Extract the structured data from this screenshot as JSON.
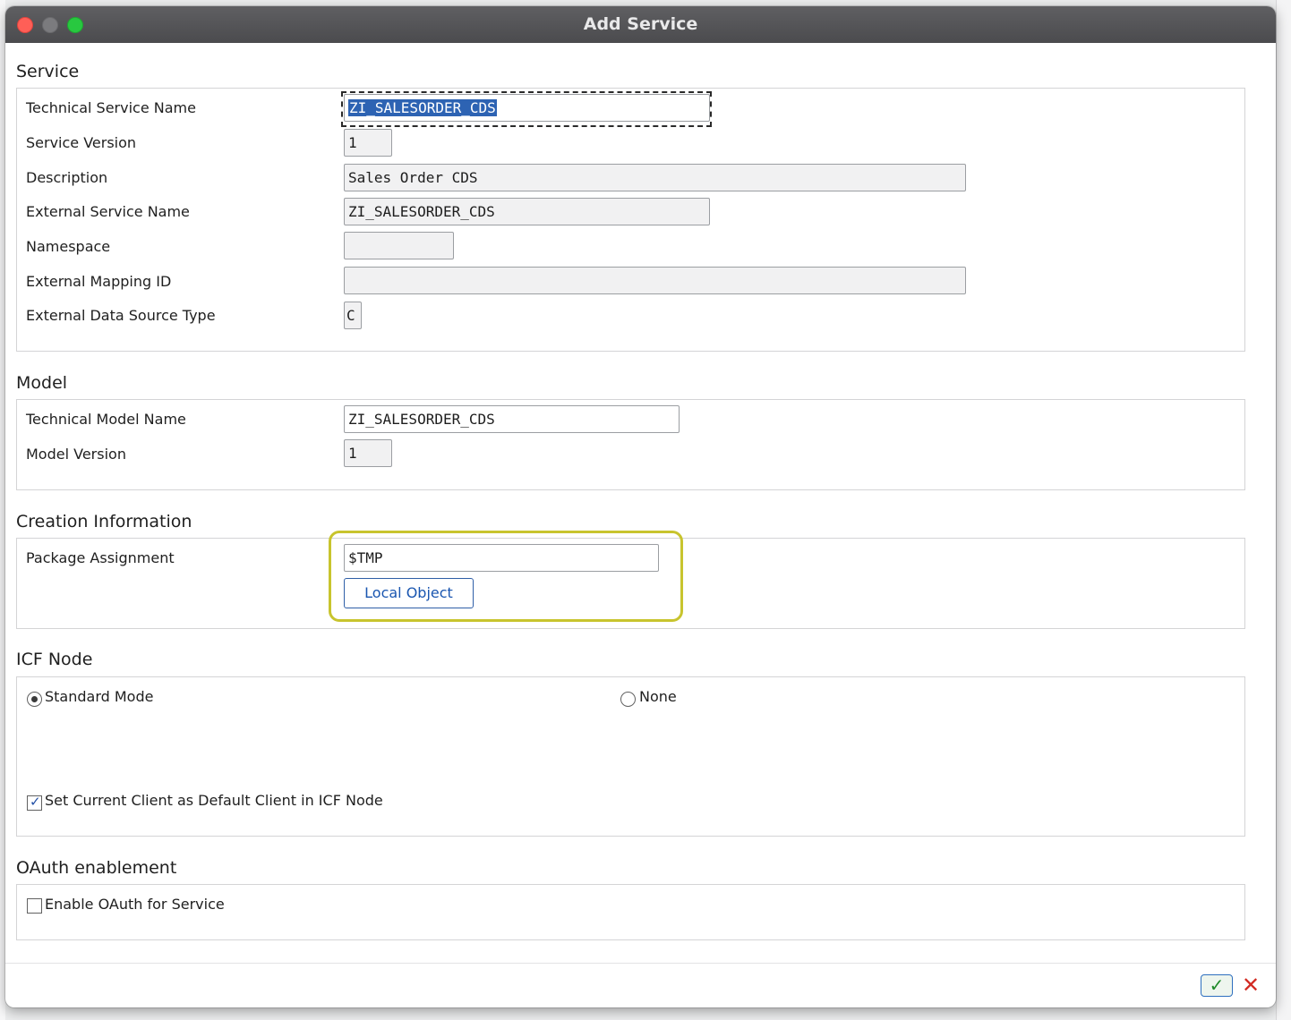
{
  "window": {
    "title": "Add Service"
  },
  "service": {
    "section_title": "Service",
    "technical_service_name": {
      "label": "Technical Service Name",
      "value": "ZI_SALESORDER_CDS"
    },
    "service_version": {
      "label": "Service Version",
      "value": "1"
    },
    "description": {
      "label": "Description",
      "value": "Sales Order CDS"
    },
    "external_service_name": {
      "label": "External Service Name",
      "value": "ZI_SALESORDER_CDS"
    },
    "namespace": {
      "label": "Namespace",
      "value": ""
    },
    "external_mapping_id": {
      "label": "External Mapping ID",
      "value": ""
    },
    "external_data_source_type": {
      "label": "External Data Source Type",
      "value": "C"
    }
  },
  "model": {
    "section_title": "Model",
    "technical_model_name": {
      "label": "Technical Model Name",
      "value": "ZI_SALESORDER_CDS"
    },
    "model_version": {
      "label": "Model Version",
      "value": "1"
    }
  },
  "creation": {
    "section_title": "Creation Information",
    "package_assignment": {
      "label": "Package Assignment",
      "value": "$TMP"
    },
    "local_object_label": "Local Object"
  },
  "icf": {
    "section_title": "ICF Node",
    "standard_mode": {
      "label": "Standard Mode",
      "selected": true
    },
    "none": {
      "label": "None",
      "selected": false
    },
    "default_client": {
      "label": "Set Current Client as Default Client in ICF Node",
      "checked": true
    }
  },
  "oauth": {
    "section_title": "OAuth enablement",
    "enable": {
      "label": "Enable OAuth for Service",
      "checked": false
    }
  },
  "footer": {
    "ok_symbol": "✓",
    "cancel_symbol": "✕"
  },
  "colors": {
    "highlight_border": "#c8c42e",
    "selection": "#2d63b3",
    "ok": "#1f8a2a",
    "cancel": "#d22a22"
  }
}
